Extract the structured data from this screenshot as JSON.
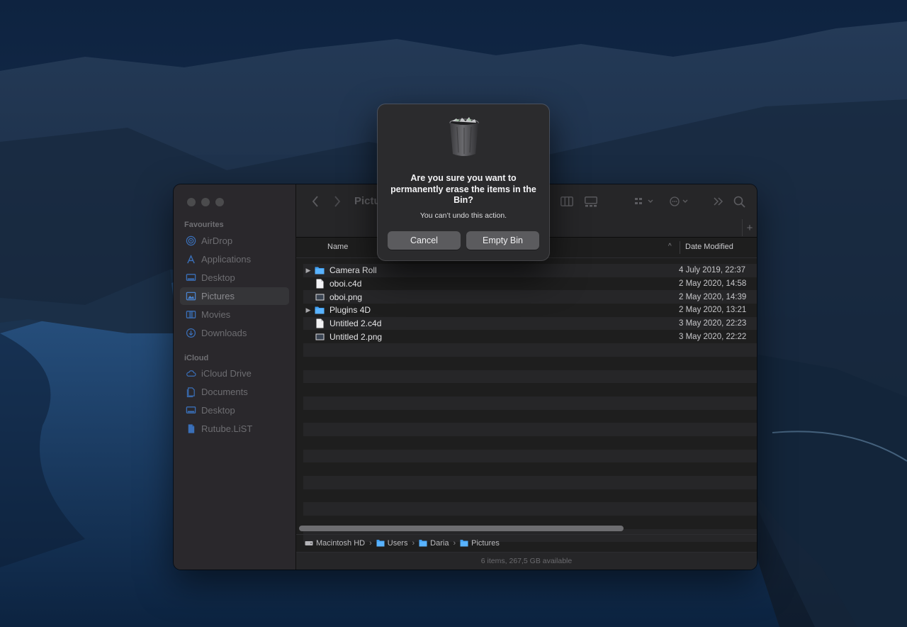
{
  "colors": {
    "folder": "#3f9ff2",
    "dialog_bg": "#2b2b2d",
    "button": "#5b5b5e"
  },
  "toolbar": {
    "title": "Pictu",
    "icons": [
      "back-icon",
      "forward-icon",
      "column-view-icon",
      "gallery-view-icon",
      "group-icon",
      "more-actions-icon",
      "overflow-icon",
      "search-icon"
    ]
  },
  "sidebar": {
    "favourites_heading": "Favourites",
    "favourites": [
      {
        "label": "AirDrop",
        "icon": "airdrop-icon"
      },
      {
        "label": "Applications",
        "icon": "applications-icon"
      },
      {
        "label": "Desktop",
        "icon": "desktop-icon"
      },
      {
        "label": "Pictures",
        "icon": "pictures-icon",
        "selected": true
      },
      {
        "label": "Movies",
        "icon": "movies-icon"
      },
      {
        "label": "Downloads",
        "icon": "downloads-icon"
      }
    ],
    "icloud_heading": "iCloud",
    "icloud": [
      {
        "label": "iCloud Drive",
        "icon": "icloud-icon"
      },
      {
        "label": "Documents",
        "icon": "documents-icon"
      },
      {
        "label": "Desktop",
        "icon": "desktop-icon"
      },
      {
        "label": "Rutube.LiST",
        "icon": "document-icon"
      }
    ]
  },
  "columns": {
    "name": "Name",
    "date": "Date Modified"
  },
  "files": [
    {
      "name": "Camera Roll",
      "date": "4 July 2019, 22:37",
      "kind": "folder"
    },
    {
      "name": "oboi.c4d",
      "date": "2 May 2020, 14:58",
      "kind": "file"
    },
    {
      "name": "oboi.png",
      "date": "2 May 2020, 14:39",
      "kind": "image"
    },
    {
      "name": "Plugins 4D",
      "date": "2 May 2020, 13:21",
      "kind": "folder"
    },
    {
      "name": "Untitled 2.c4d",
      "date": "3 May 2020, 22:23",
      "kind": "file"
    },
    {
      "name": "Untitled 2.png",
      "date": "3 May 2020, 22:22",
      "kind": "image"
    }
  ],
  "pathbar": [
    {
      "label": "Macintosh HD",
      "icon": "hard-drive-icon"
    },
    {
      "label": "Users",
      "icon": "folder-icon"
    },
    {
      "label": "Daria",
      "icon": "folder-icon"
    },
    {
      "label": "Pictures",
      "icon": "folder-icon"
    }
  ],
  "status": "6 items, 267,5 GB available",
  "dialog": {
    "icon": "trash-full-icon",
    "title": "Are you sure you want to permanently erase the items in the Bin?",
    "message": "You can’t undo this action.",
    "cancel_label": "Cancel",
    "confirm_label": "Empty Bin"
  }
}
